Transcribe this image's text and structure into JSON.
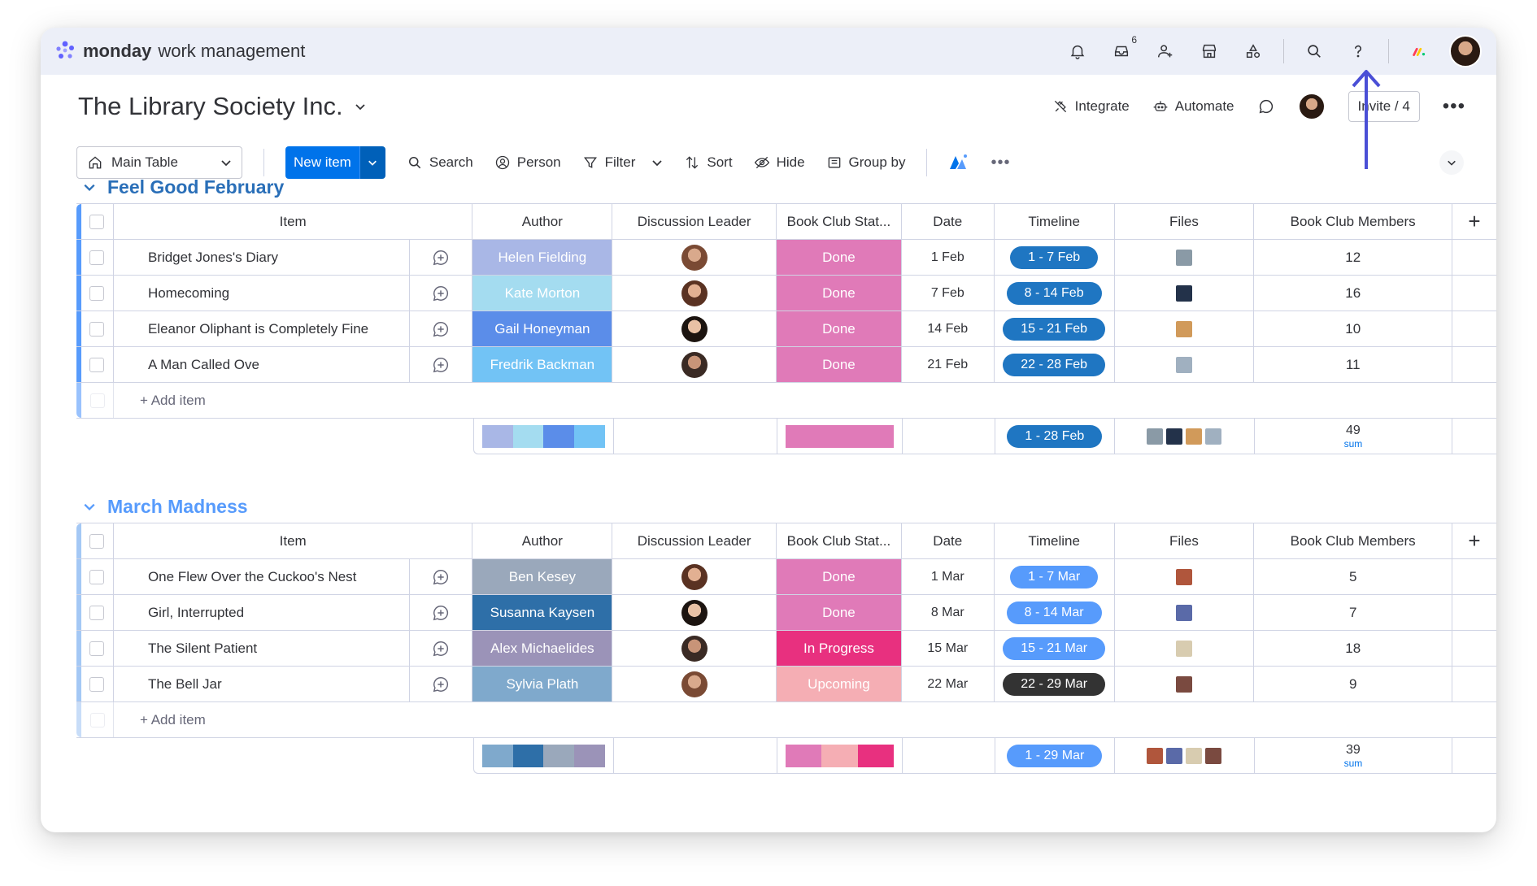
{
  "app": {
    "logo_brand": "monday",
    "logo_sub": "work management",
    "inbox_badge": "6"
  },
  "header": {
    "title": "The Library Society Inc.",
    "integrate": "Integrate",
    "automate": "Automate",
    "invite": "Invite / 4"
  },
  "toolbar": {
    "view": "Main Table",
    "new_item": "New item",
    "search": "Search",
    "person": "Person",
    "filter": "Filter",
    "sort": "Sort",
    "hide": "Hide",
    "group_by": "Group by"
  },
  "columns": {
    "item": "Item",
    "author": "Author",
    "leader": "Discussion Leader",
    "status": "Book Club Stat...",
    "date": "Date",
    "timeline": "Timeline",
    "files": "Files",
    "members": "Book Club Members"
  },
  "groups": [
    {
      "title": "Feel Good February",
      "color": "#579bfc",
      "title_color": "#2a6fb8",
      "rows": [
        {
          "item": "Bridget Jones's Diary",
          "author": "Helen Fielding",
          "author_color": "#a9b7e6",
          "status": "Done",
          "status_color": "#e07ab8",
          "date": "1 Feb",
          "timeline": "1 - 7 Feb",
          "timeline_color": "#1f76c2",
          "members": "12"
        },
        {
          "item": "Homecoming",
          "author": "Kate Morton",
          "author_color": "#a4dcf0",
          "status": "Done",
          "status_color": "#e07ab8",
          "date": "7 Feb",
          "timeline": "8 - 14 Feb",
          "timeline_color": "#1f76c2",
          "members": "16"
        },
        {
          "item": "Eleanor Oliphant is Completely Fine",
          "author": "Gail Honeyman",
          "author_color": "#5b8de9",
          "status": "Done",
          "status_color": "#e07ab8",
          "date": "14 Feb",
          "timeline": "15 - 21 Feb",
          "timeline_color": "#1f76c2",
          "members": "10"
        },
        {
          "item": "A Man Called Ove",
          "author": "Fredrik Backman",
          "author_color": "#72c3f5",
          "status": "Done",
          "status_color": "#e07ab8",
          "date": "21 Feb",
          "timeline": "22 - 28 Feb",
          "timeline_color": "#1f76c2",
          "members": "11"
        }
      ],
      "add_item": "+ Add item",
      "summary": {
        "timeline": "1 - 28 Feb",
        "members_sum": "49",
        "sum_label": "sum",
        "author_colors": [
          "#a9b7e6",
          "#a4dcf0",
          "#5b8de9",
          "#72c3f5"
        ],
        "status_colors": [
          "#e07ab8"
        ]
      }
    },
    {
      "title": "March Madness",
      "color": "#a4c8f5",
      "title_color": "#579bfc",
      "rows": [
        {
          "item": "One Flew Over the Cuckoo's Nest",
          "author": "Ben Kesey",
          "author_color": "#9aa8bb",
          "status": "Done",
          "status_color": "#e07ab8",
          "date": "1 Mar",
          "timeline": "1 - 7 Mar",
          "timeline_color": "#579bfc",
          "members": "5"
        },
        {
          "item": "Girl, Interrupted",
          "author": "Susanna Kaysen",
          "author_color": "#2e6fa8",
          "status": "Done",
          "status_color": "#e07ab8",
          "date": "8 Mar",
          "timeline": "8 - 14 Mar",
          "timeline_color": "#579bfc",
          "members": "7"
        },
        {
          "item": "The Silent Patient",
          "author": "Alex Michaelides",
          "author_color": "#9b93b8",
          "status": "In Progress",
          "status_color": "#e8307f",
          "date": "15 Mar",
          "timeline": "15 - 21 Mar",
          "timeline_color": "#579bfc",
          "members": "18"
        },
        {
          "item": "The Bell Jar",
          "author": "Sylvia Plath",
          "author_color": "#7fa9cc",
          "status": "Upcoming",
          "status_color": "#f5aeb4",
          "date": "22 Mar",
          "timeline": "22 - 29 Mar",
          "timeline_color": "#333333",
          "members": "9"
        }
      ],
      "add_item": "+ Add item",
      "summary": {
        "timeline": "1 - 29 Mar",
        "members_sum": "39",
        "sum_label": "sum",
        "author_colors": [
          "#7fa9cc",
          "#2e6fa8",
          "#9aa8bb",
          "#9b93b8"
        ],
        "status_colors": [
          "#e07ab8",
          "#f5aeb4",
          "#e8307f"
        ]
      }
    }
  ]
}
